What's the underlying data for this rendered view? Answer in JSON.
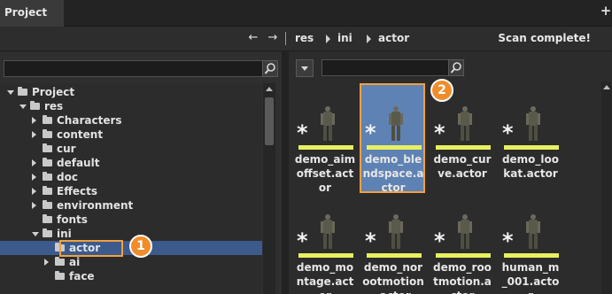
{
  "title_tab": "Project",
  "title_plus": "+",
  "nav": {
    "back": "←",
    "forward": "→",
    "breadcrumbs": [
      "res",
      "ini",
      "actor"
    ],
    "status": "Scan complete!"
  },
  "tree": {
    "search_placeholder": "",
    "items": [
      {
        "label": "Project",
        "depth": 0,
        "state": "expanded"
      },
      {
        "label": "res",
        "depth": 1,
        "state": "expanded"
      },
      {
        "label": "Characters",
        "depth": 2,
        "state": "collapsed"
      },
      {
        "label": "content",
        "depth": 2,
        "state": "collapsed"
      },
      {
        "label": "cur",
        "depth": 2,
        "state": "leaf"
      },
      {
        "label": "default",
        "depth": 2,
        "state": "collapsed"
      },
      {
        "label": "doc",
        "depth": 2,
        "state": "collapsed"
      },
      {
        "label": "Effects",
        "depth": 2,
        "state": "collapsed"
      },
      {
        "label": "environment",
        "depth": 2,
        "state": "collapsed"
      },
      {
        "label": "fonts",
        "depth": 2,
        "state": "leaf"
      },
      {
        "label": "ini",
        "depth": 2,
        "state": "expanded"
      },
      {
        "label": "actor",
        "depth": 3,
        "state": "leaf",
        "selected": true
      },
      {
        "label": "ai",
        "depth": 3,
        "state": "collapsed"
      },
      {
        "label": "face",
        "depth": 3,
        "state": "leaf"
      }
    ]
  },
  "badges": {
    "one": "1",
    "two": "2"
  },
  "assets": [
    {
      "line1": "demo_aim",
      "line2": "offset.act",
      "line3": "or"
    },
    {
      "line1": "demo_ble",
      "line2": "ndspace.a",
      "line3": "ctor",
      "selected": true
    },
    {
      "line1": "demo_cur",
      "line2": "ve.actor",
      "line3": ""
    },
    {
      "line1": "demo_loo",
      "line2": "kat.actor",
      "line3": ""
    },
    {
      "line1": "demo_mo",
      "line2": "ntage.act",
      "line3": "or"
    },
    {
      "line1": "demo_nor",
      "line2": "ootmotion",
      "line3": ".actor"
    },
    {
      "line1": "demo_roo",
      "line2": "tmotion.a",
      "line3": "ctor"
    },
    {
      "line1": "human_m",
      "line2": "_001.acto",
      "line3": "r"
    }
  ],
  "asset_star": "*",
  "colors": {
    "accent_orange": "#f08d2a",
    "selection_blue": "#3c5a8c",
    "tile_selected": "#5f82b4",
    "asset_bar": "#e8f060"
  },
  "icons": {
    "search": "magnifier-icon",
    "folder": "folder-icon",
    "asset": "character-figure-icon"
  }
}
